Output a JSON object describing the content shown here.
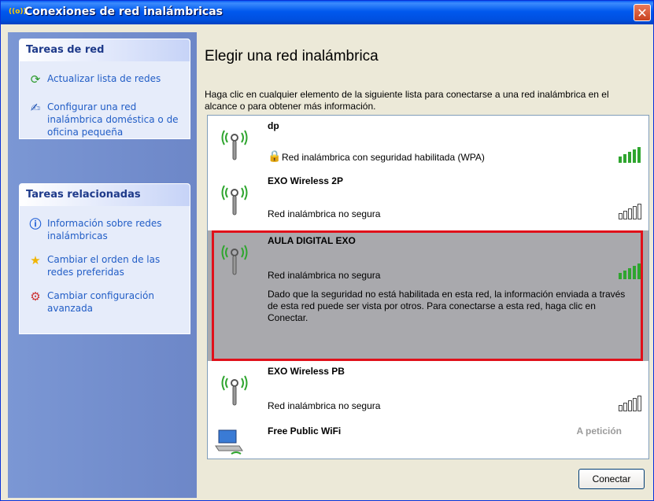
{
  "window": {
    "title": "Conexiones de red inalámbricas",
    "title_icon": "wireless-icon",
    "close_label": "✕"
  },
  "tasks_network": {
    "heading": "Tareas de red",
    "items": [
      {
        "label": "Actualizar lista de redes",
        "icon": "refresh-icon"
      },
      {
        "label": "Configurar una red inalámbrica doméstica o de oficina pequeña",
        "icon": "wizard-icon"
      }
    ]
  },
  "tasks_related": {
    "heading": "Tareas relacionadas",
    "items": [
      {
        "label": "Información sobre redes inalámbricas",
        "icon": "info-icon"
      },
      {
        "label": "Cambiar el orden de las redes preferidas",
        "icon": "star-icon"
      },
      {
        "label": "Cambiar configuración avanzada",
        "icon": "settings-icon"
      }
    ]
  },
  "main": {
    "heading": "Elegir una red inalámbrica",
    "description": "Haga clic en cualquier elemento de la siguiente lista para conectarse a una red inalámbrica en el alcance o para obtener más información."
  },
  "networks": [
    {
      "name": "dp",
      "status": "Red inalámbrica con seguridad habilitada (WPA)",
      "secured": true,
      "signal_bars": 5
    },
    {
      "name": "EXO Wireless 2P",
      "status": "Red inalámbrica no segura",
      "secured": false,
      "signal_bars": 0
    },
    {
      "name": "AULA DIGITAL EXO",
      "status": "Red inalámbrica no segura",
      "secured": false,
      "signal_bars": 5,
      "selected": true,
      "info": "Dado que la seguridad no está habilitada en esta red, la información enviada a través de esta red puede ser vista por otros. Para conectarse a esta red, haga clic en Conectar."
    },
    {
      "name": "EXO Wireless PB",
      "status": "Red inalámbrica no segura",
      "secured": false,
      "signal_bars": 0
    },
    {
      "name": "Free Public WiFi",
      "status": "",
      "badge": "A petición",
      "type": "ad-hoc"
    }
  ],
  "buttons": {
    "connect": "Conectar"
  },
  "colors": {
    "selected_border": "#e0101a",
    "signal_green": "#2fa52f",
    "link": "#215dc6"
  }
}
